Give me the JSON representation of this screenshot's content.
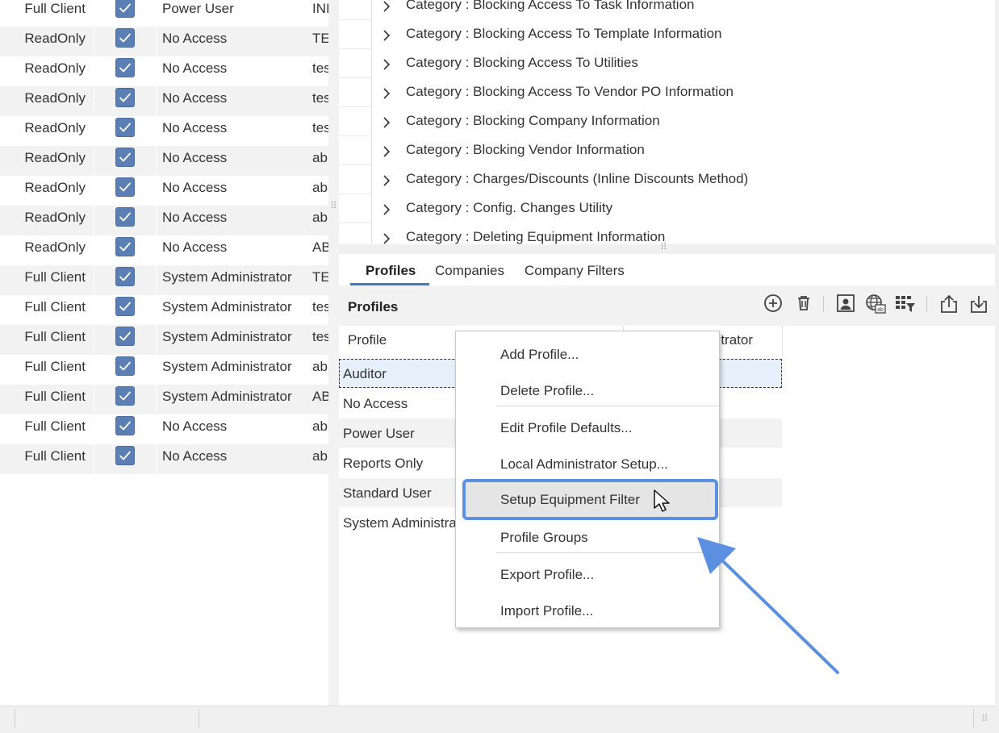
{
  "users_grid": {
    "rows": [
      {
        "client": "Full Client",
        "checked": true,
        "profile": "Power User",
        "name": "INI"
      },
      {
        "client": "ReadOnly",
        "checked": true,
        "profile": "No Access",
        "name": "TES"
      },
      {
        "client": "ReadOnly",
        "checked": true,
        "profile": "No Access",
        "name": "tes"
      },
      {
        "client": "ReadOnly",
        "checked": true,
        "profile": "No Access",
        "name": "tes"
      },
      {
        "client": "ReadOnly",
        "checked": true,
        "profile": "No Access",
        "name": "tes"
      },
      {
        "client": "ReadOnly",
        "checked": true,
        "profile": "No Access",
        "name": "ab"
      },
      {
        "client": "ReadOnly",
        "checked": true,
        "profile": "No Access",
        "name": "ab"
      },
      {
        "client": "ReadOnly",
        "checked": true,
        "profile": "No Access",
        "name": "ab"
      },
      {
        "client": "ReadOnly",
        "checked": true,
        "profile": "No Access",
        "name": "AB"
      },
      {
        "client": "Full Client",
        "checked": true,
        "profile": "System Administrator",
        "name": "TES"
      },
      {
        "client": "Full Client",
        "checked": true,
        "profile": "System Administrator",
        "name": "tes"
      },
      {
        "client": "Full Client",
        "checked": true,
        "profile": "System Administrator",
        "name": "tes"
      },
      {
        "client": "Full Client",
        "checked": true,
        "profile": "System Administrator",
        "name": "ab"
      },
      {
        "client": "Full Client",
        "checked": true,
        "profile": "System Administrator",
        "name": "AB"
      },
      {
        "client": "Full Client",
        "checked": true,
        "profile": "No Access",
        "name": "ab"
      },
      {
        "client": "Full Client",
        "checked": true,
        "profile": "No Access",
        "name": "ab"
      }
    ]
  },
  "category_tree": {
    "items": [
      "Category : Blocking Access To Task Information",
      "Category : Blocking Access To Template Information",
      "Category : Blocking Access To Utilities",
      "Category : Blocking Access To Vendor PO Information",
      "Category : Blocking Company Information",
      "Category : Blocking Vendor Information",
      "Category : Charges/Discounts (Inline Discounts Method)",
      "Category : Config. Changes Utility",
      "Category : Deleting Equipment Information"
    ]
  },
  "tabs": [
    {
      "label": "Profiles",
      "active": true
    },
    {
      "label": "Companies",
      "active": false
    },
    {
      "label": "Company Filters",
      "active": false
    }
  ],
  "toolbar": {
    "title": "Profiles",
    "icons": [
      "add-circle-icon",
      "trash-icon",
      "user-profile-icon",
      "globe-language-icon",
      "grid-filter-icon",
      "export-icon",
      "import-icon"
    ]
  },
  "profile_grid": {
    "header_profile": "Profile",
    "header_second": "trator",
    "rows": [
      "Auditor",
      "No Access",
      "Power User",
      "Reports Only",
      "Standard User",
      "System Administra"
    ]
  },
  "context_menu": {
    "items": [
      "Add Profile...",
      "Delete Profile...",
      "Edit Profile Defaults...",
      "Local Administrator Setup...",
      "Setup Equipment Filter",
      "Profile Groups",
      "Export Profile...",
      "Import Profile..."
    ],
    "highlighted": "Setup Equipment Filter"
  },
  "colors": {
    "accent": "#3b7dc4",
    "checkbox": "#5b7fb4",
    "annotation": "#5b8fe0"
  }
}
